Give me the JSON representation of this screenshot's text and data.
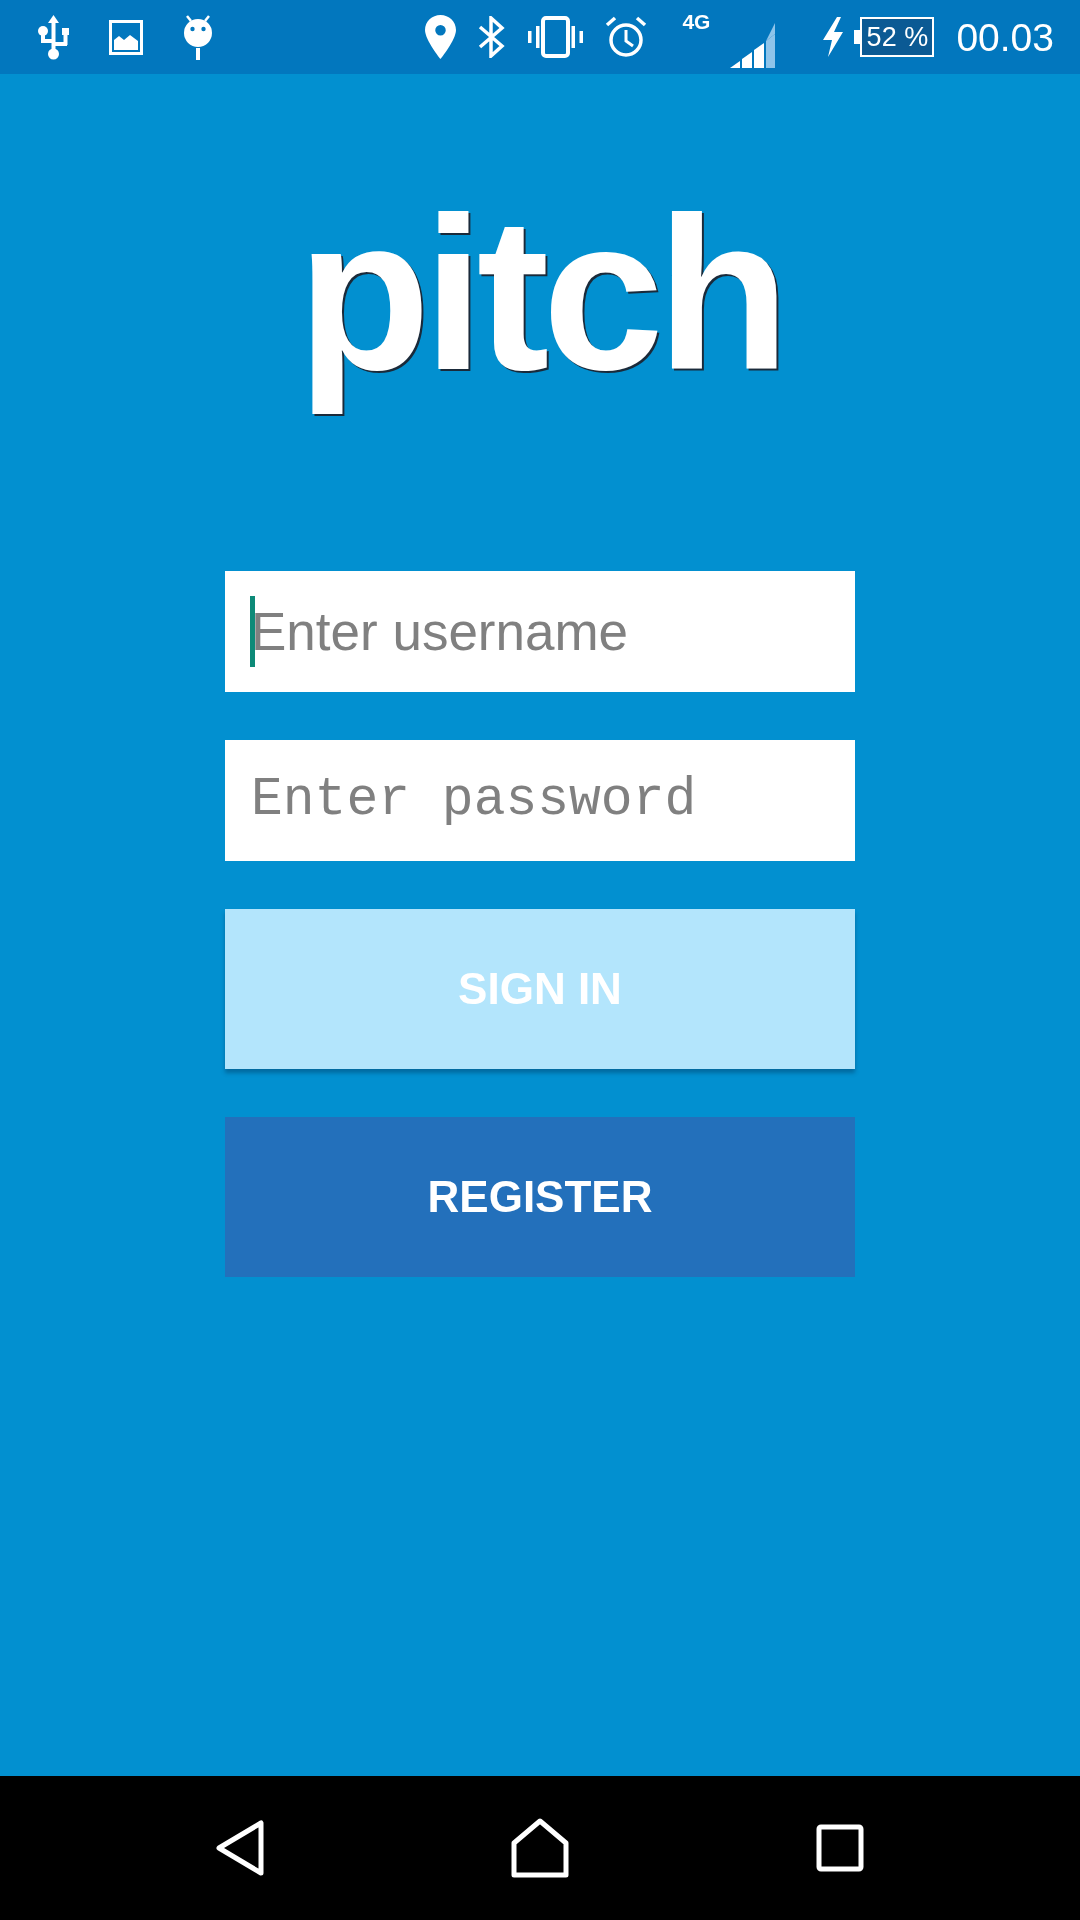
{
  "status_bar": {
    "network_type": "4G",
    "battery": "52 %",
    "time": "00.03"
  },
  "logo": {
    "text": "pitch"
  },
  "fields": [
    {
      "kind": "text",
      "placeholder": "Enter username",
      "focused": true
    },
    {
      "kind": "password",
      "placeholder": "Enter password",
      "focused": false
    }
  ],
  "buttons": [
    {
      "label": "SIGN IN",
      "kind": "raised"
    },
    {
      "label": "REGISTER",
      "kind": "flat"
    }
  ]
}
